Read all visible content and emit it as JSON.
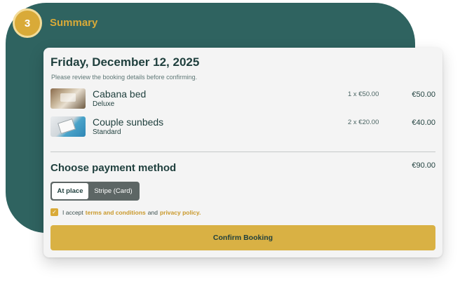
{
  "step": {
    "number": "3",
    "title": "Summary"
  },
  "booking": {
    "date": "Friday, December 12, 2025",
    "note": "Please review the booking details before confirming."
  },
  "items": [
    {
      "name": "Cabana bed",
      "variant": "Deluxe",
      "qty": "1 x €50.00",
      "total": "€50.00",
      "image": "cabana-bed-photo"
    },
    {
      "name": "Couple sunbeds",
      "variant": "Standard",
      "qty": "2 x €20.00",
      "total": "€40.00",
      "image": "sunbeds-photo"
    }
  ],
  "payment": {
    "title": "Choose payment method",
    "total": "€90.00",
    "options": [
      "At place",
      "Stripe (Card)"
    ],
    "selected": "At place"
  },
  "terms": {
    "checked": true,
    "prefix": "I accept",
    "terms_link": "terms and conditions",
    "and": "and",
    "privacy_link": "privacy policy."
  },
  "confirm_label": "Confirm Booking",
  "colors": {
    "panel": "#2f6360",
    "accent": "#d9aa38",
    "text": "#1f3f3d"
  }
}
